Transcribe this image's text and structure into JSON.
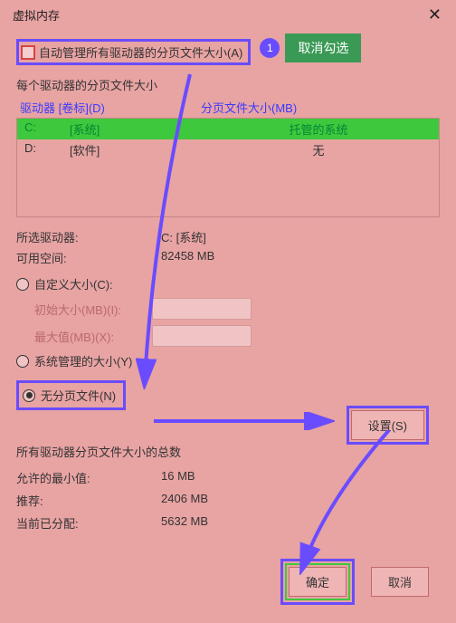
{
  "window": {
    "title": "虚拟内存"
  },
  "auto": {
    "label": "自动管理所有驱动器的分页文件大小(A)"
  },
  "callouts": {
    "one": "1",
    "tip": "取消勾选"
  },
  "perDrive": {
    "title": "每个驱动器的分页文件大小"
  },
  "headers": {
    "drive": "驱动器 [卷标](D)",
    "size": "分页文件大小(MB)"
  },
  "rows": {
    "c": {
      "letter": "C:",
      "label": "[系统]",
      "size": "托管的系统"
    },
    "d": {
      "letter": "D:",
      "label": "[软件]",
      "size": "无"
    }
  },
  "selected": {
    "driveLabel": "所选驱动器:",
    "driveValue": "C:  [系统]",
    "spaceLabel": "可用空间:",
    "spaceValue": "82458 MB"
  },
  "options": {
    "custom": "自定义大小(C):",
    "initial": "初始大小(MB)(I):",
    "max": "最大值(MB)(X):",
    "system": "系统管理的大小(Y)",
    "none": "无分页文件(N)",
    "setBtn": "设置(S)"
  },
  "totals": {
    "title": "所有驱动器分页文件大小的总数",
    "minLabel": "允许的最小值:",
    "minVal": "16 MB",
    "recLabel": "推荐:",
    "recVal": "2406 MB",
    "curLabel": "当前已分配:",
    "curVal": "5632 MB"
  },
  "buttons": {
    "ok": "确定",
    "cancel": "取消"
  }
}
